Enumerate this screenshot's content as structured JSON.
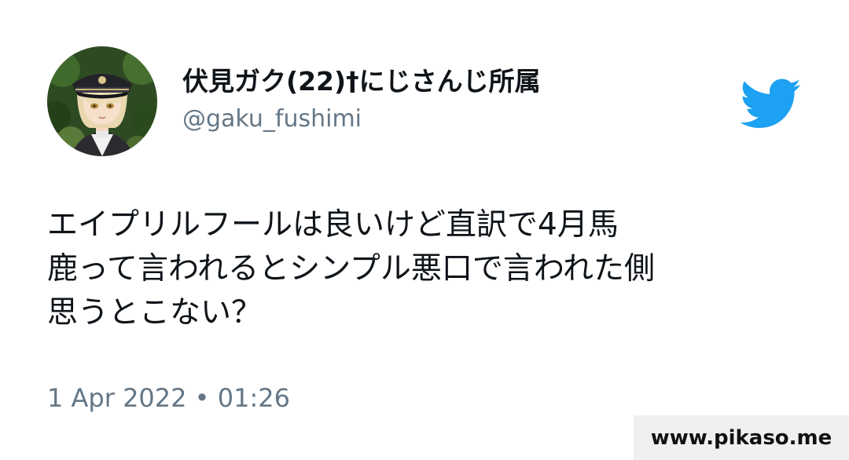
{
  "tweet": {
    "author": {
      "display_name": "伏見ガク(22)†にじさんじ所属",
      "handle": "@gaku_fushimi"
    },
    "text": "エイプリルフールは良いけど直訳で4月馬\n鹿って言われるとシンプル悪口で言われた側\n思うとこない？",
    "timestamp": "1 Apr 2022 • 01:26"
  },
  "brand": {
    "logo_icon": "twitter-bird-icon",
    "logo_color": "#1da1f2"
  },
  "watermark": {
    "text": "www.pikaso.me"
  },
  "colors": {
    "primary_text": "#0f1419",
    "secondary_text": "#657786",
    "background": "#ffffff"
  }
}
